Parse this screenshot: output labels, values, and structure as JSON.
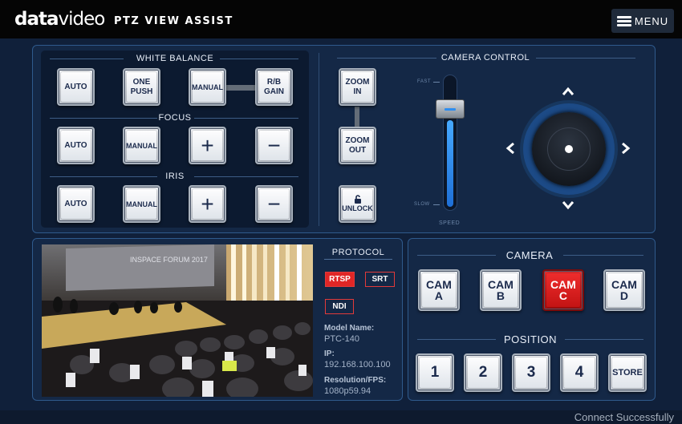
{
  "header": {
    "logo_bold": "data",
    "logo_light": "video",
    "title": "PTZ VIEW ASSIST",
    "menu_label": "MENU"
  },
  "white_balance": {
    "title": "WHITE BALANCE",
    "buttons": [
      "AUTO",
      "ONE\nPUSH",
      "MANUAL",
      "R/B\nGAIN"
    ]
  },
  "focus": {
    "title": "FOCUS",
    "buttons": [
      "AUTO",
      "MANUAL",
      "+",
      "−"
    ]
  },
  "iris": {
    "title": "IRIS",
    "buttons": [
      "AUTO",
      "MANUAL",
      "+",
      "−"
    ]
  },
  "zoom": {
    "zoom_in": "ZOOM\nIN",
    "zoom_out": "ZOOM\nOUT",
    "unlock": "UNLOCK",
    "unlock_icon": "padlock-open-icon"
  },
  "camera_control": {
    "title": "CAMERA CONTROL",
    "fast_label": "FAST",
    "slow_label": "SLOW",
    "speed_label": "SPEED",
    "speed_level": 0.82
  },
  "protocol": {
    "title": "PROTOCOL",
    "buttons": [
      "RTSP",
      "SRT",
      "NDI"
    ],
    "active": "RTSP",
    "model_label": "Model Name:",
    "model_value": "PTC-140",
    "ip_label": "IP:",
    "ip_value": "192.168.100.100",
    "res_label": "Resolution/FPS:",
    "res_value": "1080p59.94"
  },
  "preview": {
    "screen_text": "INSPACE FORUM 2017"
  },
  "camera": {
    "title": "CAMERA",
    "buttons": [
      "CAM\nA",
      "CAM\nB",
      "CAM\nC",
      "CAM\nD"
    ],
    "active": "CAM C"
  },
  "position": {
    "title": "POSITION",
    "buttons": [
      "1",
      "2",
      "3",
      "4",
      "STORE"
    ]
  },
  "status": "Connect Successfully",
  "colors": {
    "accent_blue": "#2f5a8c",
    "active_red": "#d41f1f"
  }
}
